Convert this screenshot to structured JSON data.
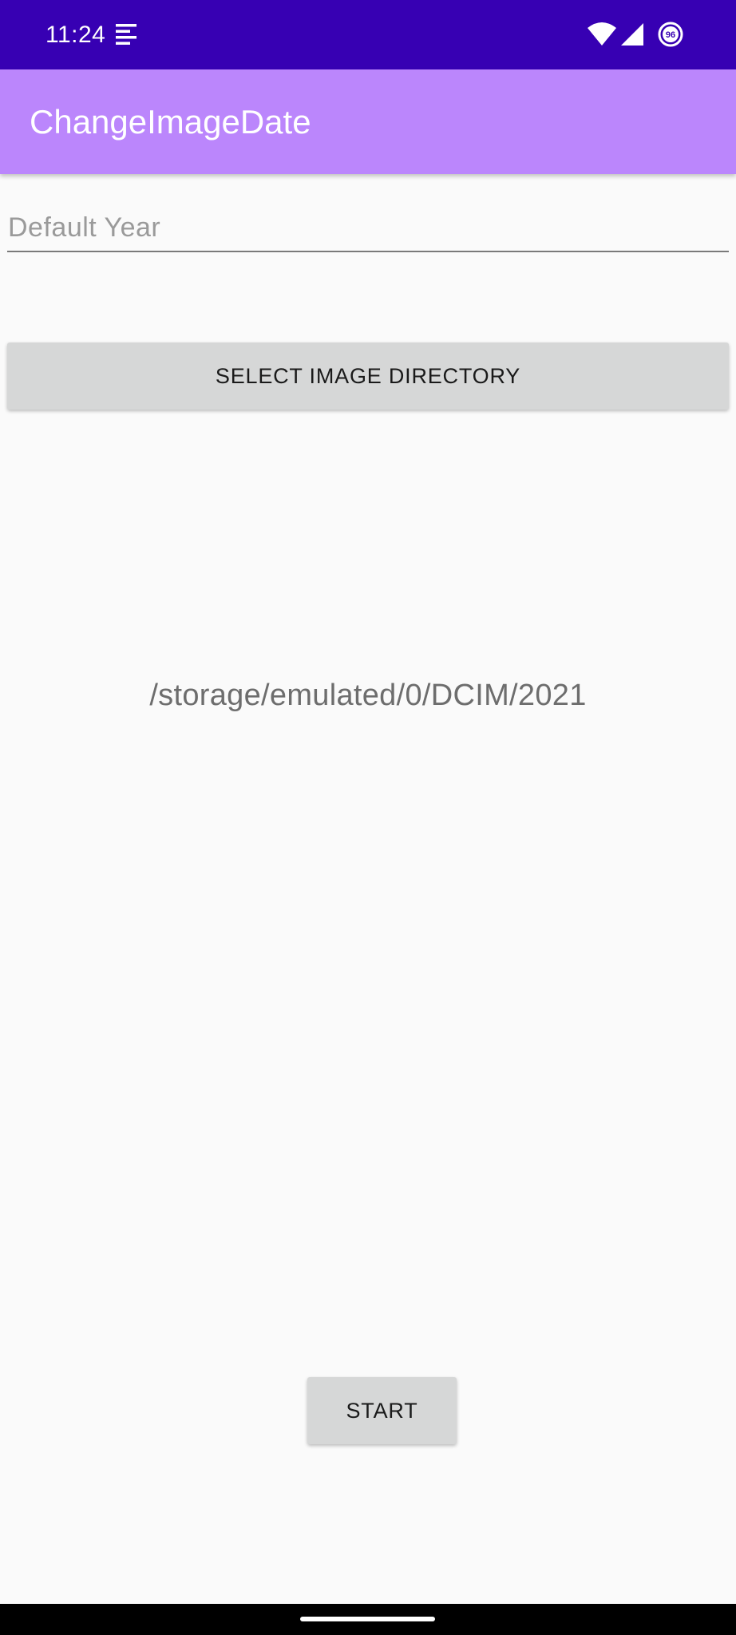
{
  "status_bar": {
    "time": "11:24",
    "battery_level": "96",
    "icons": [
      "notification-lines-icon",
      "wifi-icon",
      "cell-signal-icon",
      "battery-saver-icon"
    ],
    "background_color": "#3700b3"
  },
  "app_bar": {
    "title": "ChangeImageDate",
    "background_color": "#bb86fc"
  },
  "form": {
    "year_input_placeholder": "Default Year",
    "year_input_value": "",
    "select_directory_label": "SELECT IMAGE DIRECTORY",
    "selected_path": "/storage/emulated/0/DCIM/2021",
    "start_label": "START"
  },
  "nav_bar": {
    "icons": [
      "home-gesture-handle"
    ]
  }
}
